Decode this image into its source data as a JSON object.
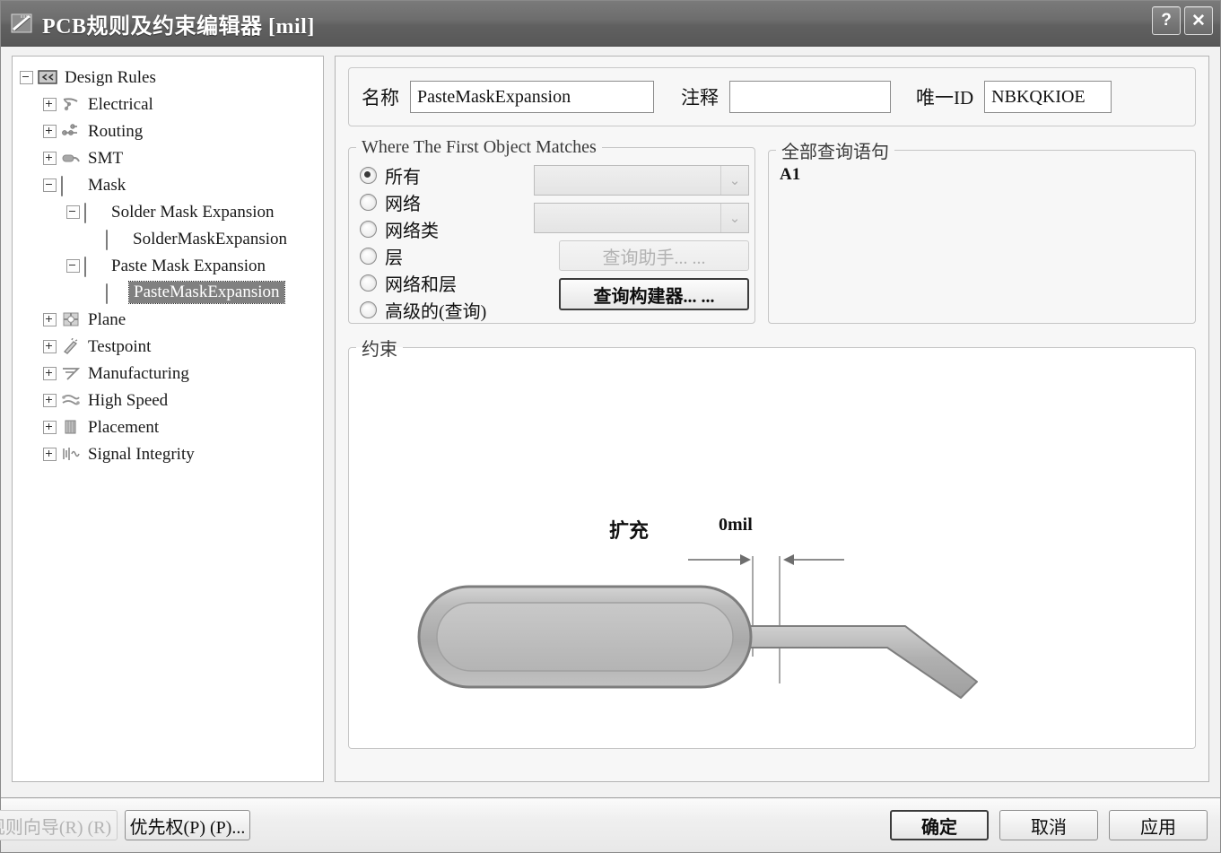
{
  "window": {
    "title": "PCB规则及约束编辑器 [mil]",
    "icon": "pcb-ruler-icon",
    "help_button": "?",
    "close_button": "✕"
  },
  "tree": {
    "name": "Design Rules",
    "items": [
      {
        "label": "Design Rules",
        "indent": 0,
        "expander": "minus",
        "icon": "design-rules-folder-icon",
        "selected": false
      },
      {
        "label": "Electrical",
        "indent": 1,
        "expander": "plus",
        "icon": "electrical-icon",
        "selected": false
      },
      {
        "label": "Routing",
        "indent": 1,
        "expander": "plus",
        "icon": "routing-icon",
        "selected": false
      },
      {
        "label": "SMT",
        "indent": 1,
        "expander": "plus",
        "icon": "smt-icon",
        "selected": false
      },
      {
        "label": "Mask",
        "indent": 1,
        "expander": "minus",
        "icon": "mask-pad-icon",
        "selected": false
      },
      {
        "label": "Solder Mask Expansion",
        "indent": 2,
        "expander": "minus",
        "icon": "mask-pad-icon",
        "selected": false
      },
      {
        "label": "SolderMaskExpansion",
        "indent": 3,
        "expander": "none",
        "icon": "mask-pad-icon",
        "selected": false
      },
      {
        "label": "Paste Mask Expansion",
        "indent": 2,
        "expander": "minus",
        "icon": "mask-pad-icon",
        "selected": false
      },
      {
        "label": "PasteMaskExpansion",
        "indent": 3,
        "expander": "none",
        "icon": "mask-pad-icon",
        "selected": true
      },
      {
        "label": "Plane",
        "indent": 1,
        "expander": "plus",
        "icon": "plane-icon",
        "selected": false
      },
      {
        "label": "Testpoint",
        "indent": 1,
        "expander": "plus",
        "icon": "testpoint-icon",
        "selected": false
      },
      {
        "label": "Manufacturing",
        "indent": 1,
        "expander": "plus",
        "icon": "manufacturing-icon",
        "selected": false
      },
      {
        "label": "High Speed",
        "indent": 1,
        "expander": "plus",
        "icon": "high-speed-icon",
        "selected": false
      },
      {
        "label": "Placement",
        "indent": 1,
        "expander": "plus",
        "icon": "placement-icon",
        "selected": false
      },
      {
        "label": "Signal Integrity",
        "indent": 1,
        "expander": "plus",
        "icon": "signal-integrity-icon",
        "selected": false
      }
    ]
  },
  "form": {
    "name_label": "名称",
    "name_value": "PasteMaskExpansion",
    "comment_label": "注释",
    "comment_value": "",
    "unique_id_label": "唯一ID",
    "unique_id_value": "NBKQKIOE"
  },
  "match": {
    "legend": "Where The First Object Matches",
    "options": [
      {
        "label": "所有",
        "selected": true
      },
      {
        "label": "网络",
        "selected": false
      },
      {
        "label": "网络类",
        "selected": false
      },
      {
        "label": "层",
        "selected": false
      },
      {
        "label": "网络和层",
        "selected": false
      },
      {
        "label": "高级的(查询)",
        "selected": false
      }
    ],
    "combo1_value": "",
    "combo2_value": "",
    "combo_arrow": "⌄",
    "query_helper_button": "查询助手... ...",
    "query_builder_button": "查询构建器... ..."
  },
  "query": {
    "legend": "全部查询语句",
    "text": "A1"
  },
  "constraint": {
    "legend": "约束",
    "expansion_label": "扩充",
    "dimension_value": "0mil"
  },
  "footer": {
    "rule_wizard_button": "规则向导(R) (R)",
    "priority_button": "优先权(P) (P)...",
    "ok_button": "确定",
    "cancel_button": "取消",
    "apply_button": "应用"
  },
  "colors": {
    "titlebar": "#6a6a6a",
    "selection": "#808080",
    "panel_bg": "#f2f2f2",
    "border": "#b4b4b4",
    "pad_fill": "#b0b0b0"
  }
}
